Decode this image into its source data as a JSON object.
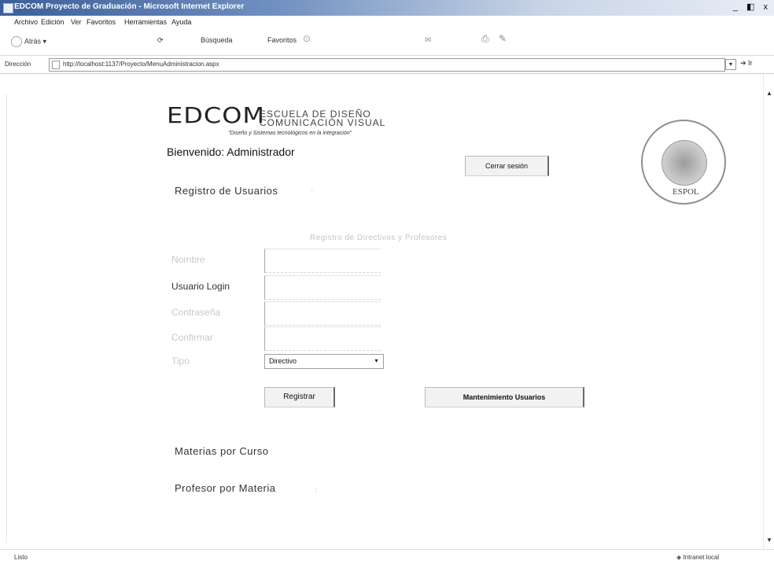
{
  "window": {
    "title": "EDCOM Proyecto de Graduación - Microsoft Internet Explorer",
    "controls": "_ ◧ x"
  },
  "menu": {
    "items": [
      "Archivo",
      "Edición",
      "Ver",
      "Favoritos",
      "Herramientas",
      "Ayuda"
    ]
  },
  "toolbar": {
    "back_label": "Atrás",
    "search_label": "Búsqueda",
    "favorites_label": "Favoritos"
  },
  "address": {
    "label": "Dirección",
    "url": "http://localhost:1137/Proyecto/MenuAdministracion.aspx",
    "go_label": "Ir"
  },
  "header": {
    "logo_text": "EDCOM",
    "school_line1": "ESCUELA DE DISEÑO",
    "school_line2": "COMUNICACIÓN VISUAL",
    "slogan": "\"Diseño y Sistemas tecnológicos en la integración\"",
    "welcome": "Bienvenido: Administrador",
    "logout_label": "Cerrar sesión",
    "seal_text": "ESPOL"
  },
  "nav": {
    "registro_usuarios": "Registro de Usuarios",
    "materias_por_curso": "Materias por Curso",
    "profesor_por_materia": "Profesor por Materia",
    "marker": ":"
  },
  "form": {
    "title": "Registro de Directivos y Profesores",
    "fields": [
      {
        "label": "Nombre",
        "value": ""
      },
      {
        "label": "Usuario Login",
        "value": ""
      },
      {
        "label": "Contraseña",
        "value": ""
      },
      {
        "label": "Confirmar",
        "value": ""
      }
    ],
    "tipo_label": "Tipo",
    "tipo_selected": "Directivo",
    "register_label": "Registrar",
    "maintenance_label": "Mantenimiento Usuarios"
  },
  "status": {
    "left": "Listo",
    "right": "Intranet local"
  }
}
